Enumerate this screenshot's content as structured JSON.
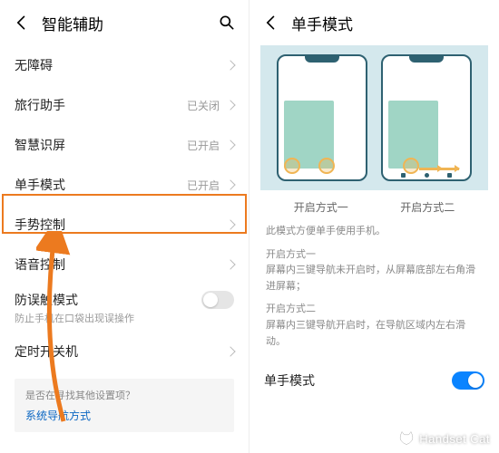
{
  "left": {
    "header_title": "智能辅助",
    "rows": {
      "accessibility": {
        "label": "无障碍"
      },
      "travel": {
        "label": "旅行助手",
        "status": "已关闭"
      },
      "smart_screen": {
        "label": "智慧识屏",
        "status": "已开启"
      },
      "one_hand": {
        "label": "单手模式",
        "status": "已开启"
      },
      "gesture": {
        "label": "手势控制"
      },
      "voice": {
        "label": "语音控制"
      },
      "mistouch": {
        "label": "防误触模式",
        "sub": "防止手机在口袋出现误操作"
      },
      "timer": {
        "label": "定时开关机"
      }
    },
    "hint": {
      "q": "是否在寻找其他设置项？",
      "link": "系统导航方式"
    }
  },
  "right": {
    "header_title": "单手模式",
    "captions": {
      "m1": "开启方式一",
      "m2": "开启方式二"
    },
    "desc_intro": "此模式方便单手使用手机。",
    "desc1_head": "开启方式一",
    "desc1_body": "屏幕内三键导航未开启时，从屏幕底部左右角滑进屏幕；",
    "desc2_head": "开启方式二",
    "desc2_body": "屏幕内三键导航开启时，在导航区域内左右滑动。",
    "toggle_label": "单手模式"
  },
  "watermark": "Handset Cat"
}
